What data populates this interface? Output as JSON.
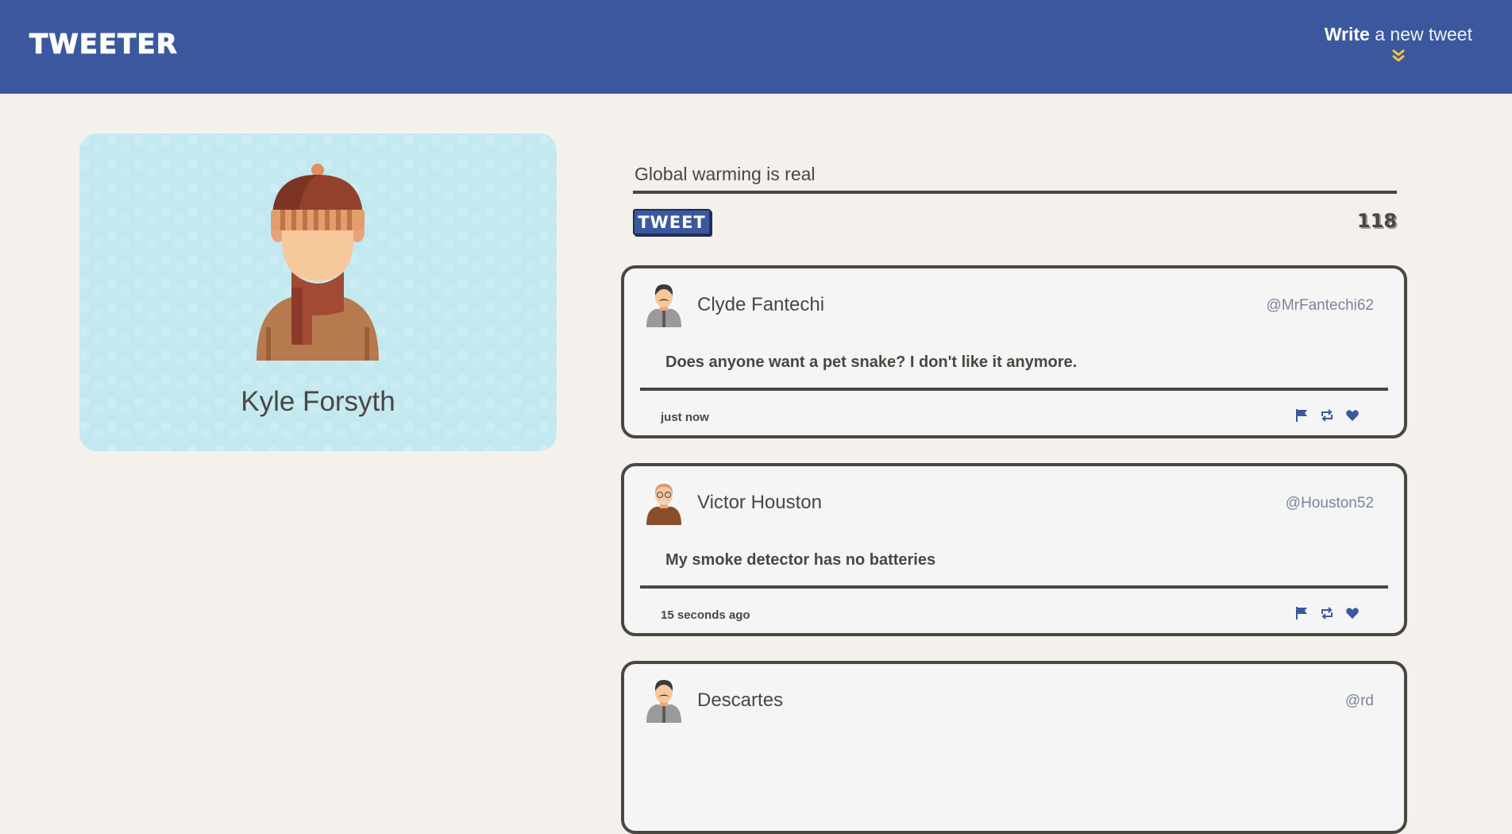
{
  "nav": {
    "logo": "TWEETER",
    "compose_bold": "Write",
    "compose_rest": " a new tweet",
    "compose_icon": "chevron-double-down-icon"
  },
  "profile": {
    "name": "Kyle Forsyth",
    "avatar": "beanie-scarf-avatar"
  },
  "composer": {
    "value": "Global warming is real",
    "button": "TWEET",
    "counter": "118"
  },
  "tweets": [
    {
      "name": "Clyde Fantechi",
      "handle": "@MrFantechi62",
      "content": "Does anyone want a pet snake? I don't like it anymore.",
      "time": "just now",
      "avatar": "mustache-man-avatar"
    },
    {
      "name": "Victor Houston",
      "handle": "@Houston52",
      "content": "My smoke detector has no batteries",
      "time": "15 seconds ago",
      "avatar": "bald-glasses-man-avatar"
    },
    {
      "name": "Descartes",
      "handle": "@rd",
      "content": "",
      "time": "",
      "avatar": "mustache-man-avatar"
    }
  ],
  "actions": [
    "flag-icon",
    "retweet-icon",
    "heart-icon"
  ],
  "colors": {
    "navbar": "#3b589f",
    "background": "#f4f1ec",
    "profile_card": "#c2e8f0",
    "text": "#4a4741",
    "accent": "#f4c542"
  }
}
